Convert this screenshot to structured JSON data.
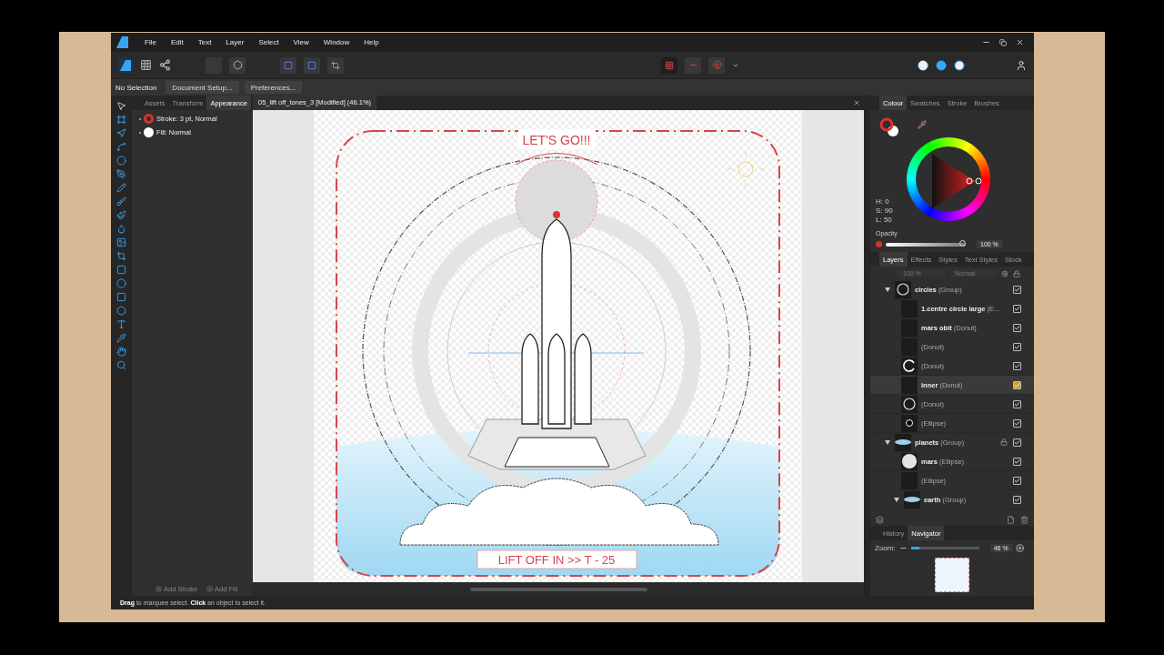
{
  "menu": [
    "File",
    "Edit",
    "Text",
    "Layer",
    "Select",
    "View",
    "Window",
    "Help"
  ],
  "context_bar": {
    "status": "No Selection",
    "buttons": [
      "Document Setup...",
      "Preferences..."
    ]
  },
  "left_panel": {
    "tabs": [
      {
        "label": "Assets",
        "selected": false
      },
      {
        "label": "Transform",
        "selected": false
      },
      {
        "label": "Appearance",
        "selected": true
      }
    ],
    "appearance": [
      {
        "kind": "stroke",
        "label": "Stroke: 3 pt,",
        "mode": "Normal"
      },
      {
        "kind": "fill",
        "label": "Fill:",
        "mode": "Normal"
      }
    ],
    "footer": [
      "Add Stroke",
      "Add Fill"
    ]
  },
  "document": {
    "title": "05_lift off_tones_3 [Modified] (46.1%)",
    "headline": "LET'S GO!!!",
    "banner": "LIFT OFF IN >> T - 25"
  },
  "colour_panel": {
    "tabs": [
      {
        "label": "Colour",
        "selected": true
      },
      {
        "label": "Swatches",
        "selected": false
      },
      {
        "label": "Stroke",
        "selected": false
      },
      {
        "label": "Brushes",
        "selected": false
      }
    ],
    "hsl": [
      "H: 0",
      "S: 90",
      "L: 50"
    ],
    "opacity_label": "Opacity",
    "opacity": {
      "level": 1
    },
    "opacity_value": "100 %"
  },
  "layers_panel": {
    "tabs": [
      {
        "label": "Layers",
        "selected": true
      },
      {
        "label": "Effects",
        "selected": false
      },
      {
        "label": "Styles",
        "selected": false
      },
      {
        "label": "Text Styles",
        "selected": false
      },
      {
        "label": "Stock",
        "selected": false
      }
    ],
    "opacity": "100 %",
    "blend": "Normal",
    "layers": [
      {
        "name": "circles",
        "type": "(Group)",
        "kind": "ring",
        "expanded": true,
        "locked": false,
        "visible": true,
        "highlighted": false,
        "children": [
          {
            "name": "1.centre circle large",
            "type": "(E...",
            "kind": "blank",
            "locked": false,
            "visible": true,
            "highlighted": false
          },
          {
            "name": "mars obit",
            "type": "(Donut)",
            "kind": "blank",
            "locked": false,
            "visible": true,
            "highlighted": false
          },
          {
            "type": "(Donut)",
            "kind": "blank",
            "locked": false,
            "visible": true,
            "highlighted": false
          },
          {
            "type": "(Donut)",
            "kind": "arc",
            "locked": false,
            "visible": true,
            "highlighted": false
          },
          {
            "name": "inner",
            "type": "(Donut)",
            "kind": "blank",
            "locked": false,
            "visible": true,
            "highlighted": true
          },
          {
            "type": "(Donut)",
            "kind": "ring",
            "locked": false,
            "visible": true,
            "highlighted": false
          },
          {
            "type": "(Ellipse)",
            "kind": "dot",
            "locked": false,
            "visible": true,
            "highlighted": false
          }
        ]
      },
      {
        "name": "planets",
        "type": "(Group)",
        "kind": "cloud",
        "expanded": true,
        "locked": true,
        "visible": true,
        "highlighted": false,
        "children": [
          {
            "name": "mars",
            "type": "(Ellipse)",
            "kind": "disc",
            "locked": false,
            "visible": true,
            "highlighted": false
          },
          {
            "type": "(Ellipse)",
            "kind": "blank",
            "locked": false,
            "visible": true,
            "highlighted": false
          },
          {
            "name": "earth",
            "type": "(Group)",
            "kind": "cloud",
            "expanded": true,
            "locked": false,
            "visible": true,
            "highlighted": false
          }
        ]
      }
    ]
  },
  "navigator": {
    "tabs": [
      {
        "label": "History",
        "selected": false
      },
      {
        "label": "Navigator",
        "selected": true
      }
    ],
    "zoom_label": "Zoom:",
    "zoom": {
      "level": 0.12
    },
    "zoom_value": "46 %"
  },
  "status_bar": "**Drag** to marquee select. **Click** an object to select it."
}
